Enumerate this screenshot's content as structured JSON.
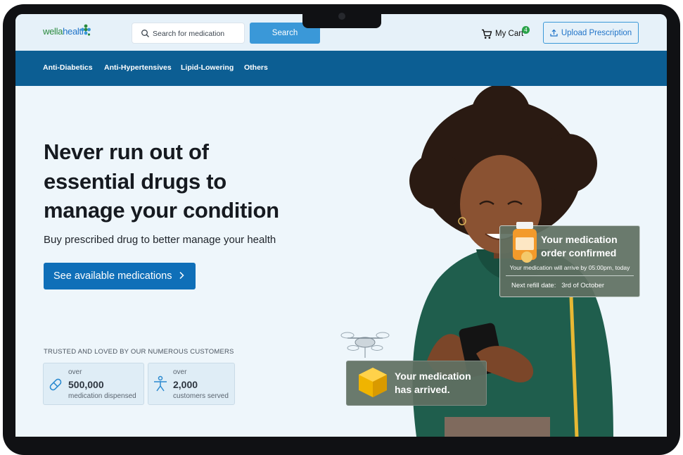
{
  "header": {
    "logo_part1": "wella",
    "logo_part2": "health",
    "search_placeholder": "Search for medication",
    "search_button": "Search",
    "cart_label": "My Cart",
    "cart_count": "4",
    "upload_label": "Upload Prescription"
  },
  "nav": {
    "items": [
      {
        "label": "Anti-Diabetics"
      },
      {
        "label": "Anti-Hypertensives"
      },
      {
        "label": "Lipid-Lowering"
      },
      {
        "label": "Others"
      }
    ]
  },
  "hero": {
    "title_line1": "Never run out of",
    "title_line2": "essential drugs to",
    "title_line3": "manage your condition",
    "subtitle": "Buy prescribed drug to better manage your health",
    "cta_label": "See available medications"
  },
  "trust": {
    "heading": "TRUSTED AND LOVED BY OUR NUMEROUS CUSTOMERS",
    "stats": [
      {
        "prefix": "over",
        "value": "500,000",
        "label": "medication dispensed",
        "icon": "pill-icon"
      },
      {
        "prefix": "over",
        "value": "2,000",
        "label": "customers served",
        "icon": "person-icon"
      }
    ]
  },
  "notifications": {
    "order": {
      "title_line1": "Your medication",
      "title_line2": "order confirmed",
      "arrival": "Your medication will arrive by 05:00pm, today",
      "refill_label": "Next refill date:",
      "refill_date": "3rd of October"
    },
    "arrived": {
      "title_line1": "Your medication",
      "title_line2": "has arrived."
    }
  },
  "colors": {
    "primary": "#0f6fb8",
    "nav_bg": "#0c5e93",
    "search_button": "#3a98d8",
    "badge": "#2aa34a",
    "page_bg": "#eef6fb"
  }
}
